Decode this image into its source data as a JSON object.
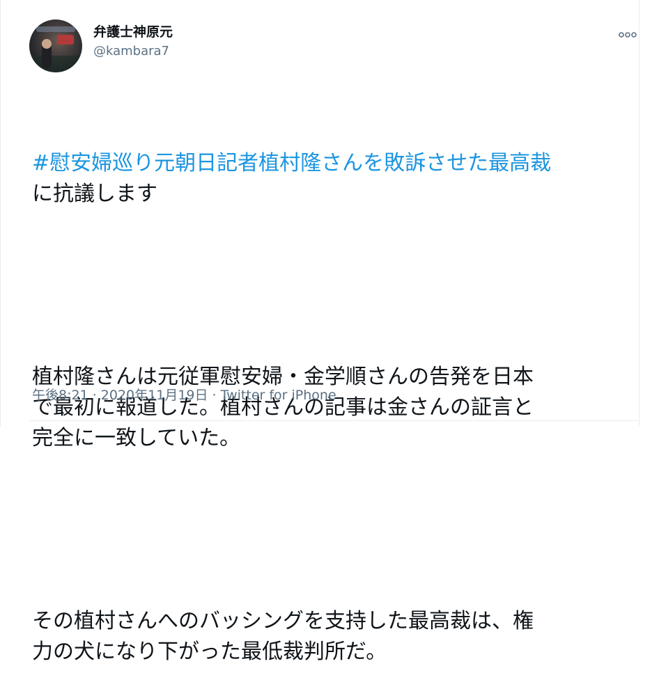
{
  "user": {
    "display_name": "弁護士神原元",
    "handle": "@kambara7"
  },
  "tweet": {
    "hashtag_line1": "#慰安婦巡り元朝日記者植村隆さんを敗訴させた最高裁",
    "hashtag_line2": "に抗議します",
    "paragraph1": "植村隆さんは元従軍慰安婦・金学順さんの告発を日本\nで最初に報道した。植村さんの記事は金さんの証言と\n完全に一致していた。",
    "paragraph2": "その植村さんへのバッシングを支持した最高裁は、権\n力の犬になり下がった最低裁判所だ。"
  },
  "meta": {
    "time": "午後8:21",
    "separator": " · ",
    "date": "2020年11月19日",
    "separator2": " · ",
    "source": "Twitter for iPhone"
  },
  "icons": {
    "more": "more-options-icon"
  },
  "colors": {
    "link": "#1b95e0",
    "secondary_text": "#5b7083",
    "text": "#0f1419",
    "border": "#e6ecf0"
  }
}
